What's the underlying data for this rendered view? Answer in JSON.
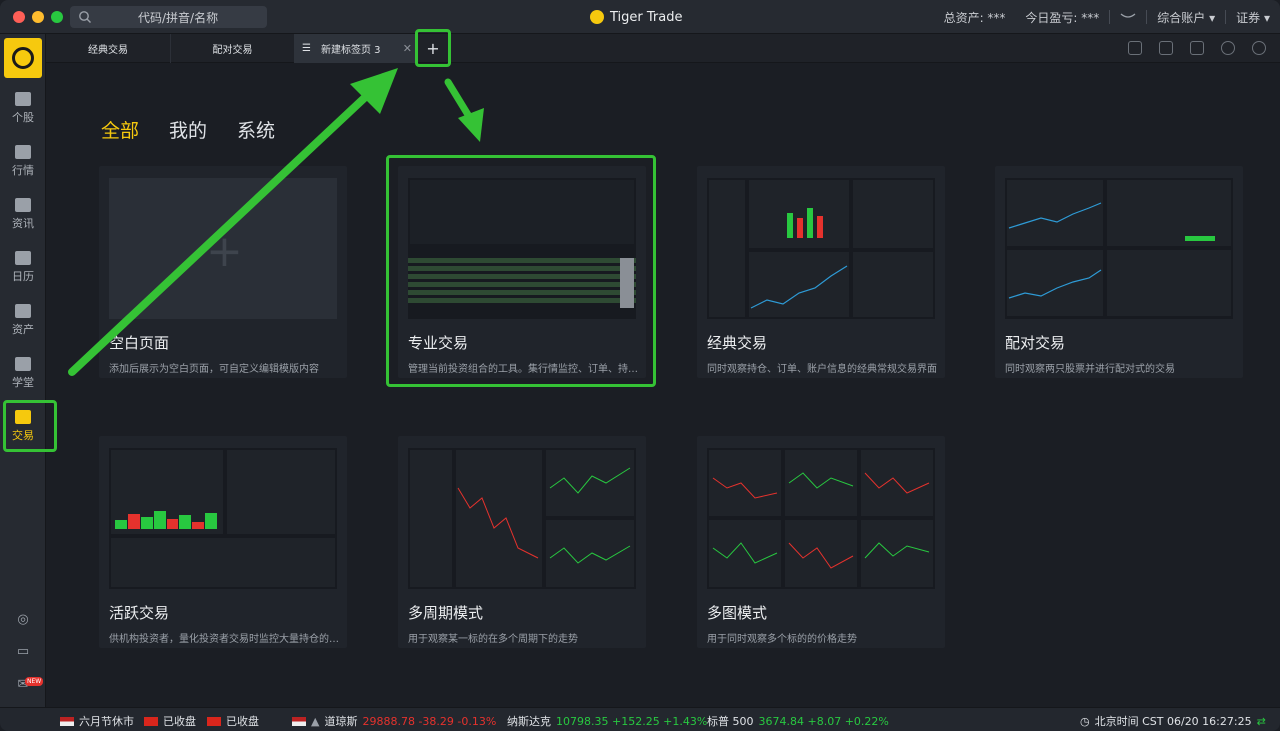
{
  "titlebar": {
    "search_placeholder": "代码/拼音/名称",
    "brand": "Tiger Trade",
    "total_assets": "总资产: ***",
    "today_pnl": "今日盈亏: ***",
    "account": "综合账户",
    "market": "证券"
  },
  "nav": {
    "items": [
      {
        "label": "个股"
      },
      {
        "label": "行情"
      },
      {
        "label": "资讯"
      },
      {
        "label": "日历"
      },
      {
        "label": "资产"
      },
      {
        "label": "学堂"
      },
      {
        "label": "交易"
      }
    ],
    "new_badge": "NEW"
  },
  "tabs": {
    "tab1": "经典交易",
    "tab2": "配对交易",
    "tab3": "新建标签页 3",
    "close": "✕",
    "add": "+"
  },
  "filters": {
    "all": "全部",
    "mine": "我的",
    "system": "系统"
  },
  "templates": [
    {
      "title": "空白页面",
      "desc": "添加后展示为空白页面，可自定义编辑模版内容"
    },
    {
      "title": "专业交易",
      "desc": "管理当前投资组合的工具。集行情监控、订单、持仓等功能于一体"
    },
    {
      "title": "经典交易",
      "desc": "同时观察持仓、订单、账户信息的经典常规交易界面"
    },
    {
      "title": "配对交易",
      "desc": "同时观察两只股票并进行配对式的交易"
    },
    {
      "title": "活跃交易",
      "desc": "供机构投资者，量化投资者交易时监控大量持仓的工具"
    },
    {
      "title": "多周期模式",
      "desc": "用于观察某一标的在多个周期下的走势"
    },
    {
      "title": "多图模式",
      "desc": "用于同时观察多个标的的价格走势"
    }
  ],
  "footer": {
    "us_status": "六月节休市",
    "hk_status": "已收盘",
    "cn_status": "已收盘",
    "dow_name": "道琼斯",
    "dow_value": "29888.78 -38.29 -0.13%",
    "nasdaq_name": "纳斯达克",
    "nasdaq_value": "10798.35 +152.25 +1.43%",
    "sp_name": "标普 500",
    "sp_value": "3674.84 +8.07 +0.22%",
    "clock": "北京时间 CST 06/20 16:27:25"
  },
  "colors": {
    "accent": "#f6c90e",
    "highlight": "#35c235",
    "up": "#28c840",
    "down": "#e5322d"
  }
}
